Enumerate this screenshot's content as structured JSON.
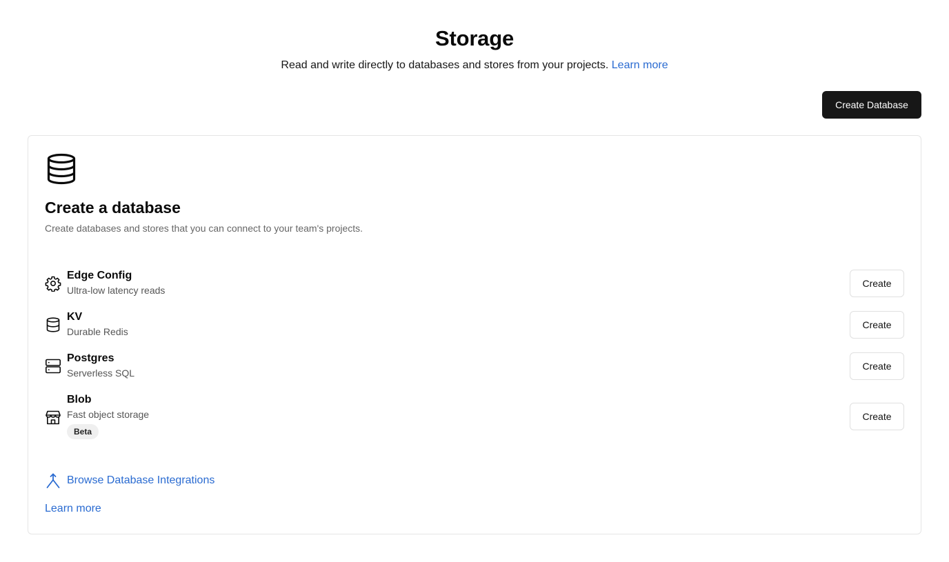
{
  "header": {
    "title": "Storage",
    "subtitle": "Read and write directly to databases and stores from your projects.",
    "learn_more": "Learn more"
  },
  "toolbar": {
    "create_database_label": "Create Database"
  },
  "card": {
    "icon": "database-icon",
    "title": "Create a database",
    "description": "Create databases and stores that you can connect to your team's projects.",
    "items": [
      {
        "icon": "gear-icon",
        "name": "Edge Config",
        "subtitle": "Ultra-low latency reads",
        "button": "Create"
      },
      {
        "icon": "database-icon",
        "name": "KV",
        "subtitle": "Durable Redis",
        "button": "Create"
      },
      {
        "icon": "server-icon",
        "name": "Postgres",
        "subtitle": "Serverless SQL",
        "button": "Create"
      },
      {
        "icon": "store-icon",
        "name": "Blob",
        "subtitle": "Fast object storage",
        "badge": "Beta",
        "button": "Create"
      }
    ],
    "browse_label": "Browse Database Integrations",
    "browse_icon": "merge-icon",
    "learn_more": "Learn more"
  },
  "colors": {
    "link": "#2a6bd1",
    "primary_button": "#171717"
  }
}
